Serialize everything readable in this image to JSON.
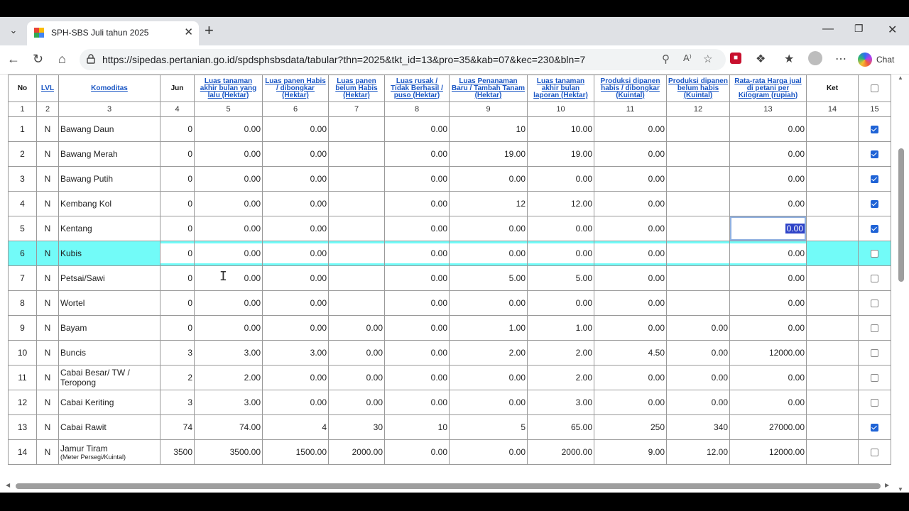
{
  "browser": {
    "tab_title": "SPH-SBS Juli tahun 2025",
    "url": "https://sipedas.pertanian.go.id/spdsphsbsdata/tabular?thn=2025&tkt_id=13&pro=35&kab=07&kec=230&bln=7",
    "chat_label": "Chat"
  },
  "table": {
    "headers": {
      "no": "No",
      "lvl": "LVL",
      "komoditas": "Komoditas",
      "jun": "Jun",
      "h5": "Luas tanaman akhir bulan yang lalu (Hektar)",
      "h6": "Luas panen Habis / dibongkar (Hektar)",
      "h7": "Luas panen belum Habis (Hektar)",
      "h8": "Luas rusak / Tidak Berhasil / puso (Hektar)",
      "h9": "Luas Penanaman Baru / Tambah Tanam (Hektar)",
      "h10": "Luas tanaman akhir bulan laporan (Hektar)",
      "h11": "Produksi dipanen habis / dibongkar (Kuintal)",
      "h12": "Produksi dipanen belum habis (Kuintal)",
      "h13": "Rata-rata Harga jual di petani per Kilogram (rupiah)",
      "ket": "Ket"
    },
    "colnums": [
      "1",
      "2",
      "3",
      "4",
      "5",
      "6",
      "7",
      "8",
      "9",
      "10",
      "11",
      "12",
      "13",
      "14",
      "15"
    ],
    "rows": [
      {
        "no": "1",
        "lvl": "N",
        "name": "Bawang Daun",
        "jun": "0",
        "c5": "0.00",
        "c6": "0.00",
        "c7": "",
        "c8": "0.00",
        "c9": "10",
        "c10": "10.00",
        "c11": "0.00",
        "c12": "",
        "c13": "0.00",
        "checked": true
      },
      {
        "no": "2",
        "lvl": "N",
        "name": "Bawang Merah",
        "jun": "0",
        "c5": "0.00",
        "c6": "0.00",
        "c7": "",
        "c8": "0.00",
        "c9": "19.00",
        "c10": "19.00",
        "c11": "0.00",
        "c12": "",
        "c13": "0.00",
        "checked": true
      },
      {
        "no": "3",
        "lvl": "N",
        "name": "Bawang Putih",
        "jun": "0",
        "c5": "0.00",
        "c6": "0.00",
        "c7": "",
        "c8": "0.00",
        "c9": "0.00",
        "c10": "0.00",
        "c11": "0.00",
        "c12": "",
        "c13": "0.00",
        "checked": true
      },
      {
        "no": "4",
        "lvl": "N",
        "name": "Kembang Kol",
        "jun": "0",
        "c5": "0.00",
        "c6": "0.00",
        "c7": "",
        "c8": "0.00",
        "c9": "12",
        "c10": "12.00",
        "c11": "0.00",
        "c12": "",
        "c13": "0.00",
        "checked": true
      },
      {
        "no": "5",
        "lvl": "N",
        "name": "Kentang",
        "jun": "0",
        "c5": "0.00",
        "c6": "0.00",
        "c7": "",
        "c8": "0.00",
        "c9": "0.00",
        "c10": "0.00",
        "c11": "0.00",
        "c12": "",
        "c13": "0.00",
        "checked": true
      },
      {
        "no": "6",
        "lvl": "N",
        "name": "Kubis",
        "jun": "0",
        "c5": "0.00",
        "c6": "0.00",
        "c7": "",
        "c8": "0.00",
        "c9": "0.00",
        "c10": "0.00",
        "c11": "0.00",
        "c12": "",
        "c13": "0.00",
        "checked": false
      },
      {
        "no": "7",
        "lvl": "N",
        "name": "Petsai/Sawi",
        "jun": "0",
        "c5": "0.00",
        "c6": "0.00",
        "c7": "",
        "c8": "0.00",
        "c9": "5.00",
        "c10": "5.00",
        "c11": "0.00",
        "c12": "",
        "c13": "0.00",
        "checked": false
      },
      {
        "no": "8",
        "lvl": "N",
        "name": "Wortel",
        "jun": "0",
        "c5": "0.00",
        "c6": "0.00",
        "c7": "",
        "c8": "0.00",
        "c9": "0.00",
        "c10": "0.00",
        "c11": "0.00",
        "c12": "",
        "c13": "0.00",
        "checked": false
      },
      {
        "no": "9",
        "lvl": "N",
        "name": "Bayam",
        "jun": "0",
        "c5": "0.00",
        "c6": "0.00",
        "c7": "0.00",
        "c8": "0.00",
        "c9": "1.00",
        "c10": "1.00",
        "c11": "0.00",
        "c12": "0.00",
        "c13": "0.00",
        "checked": false
      },
      {
        "no": "10",
        "lvl": "N",
        "name": "Buncis",
        "jun": "3",
        "c5": "3.00",
        "c6": "3.00",
        "c7": "0.00",
        "c8": "0.00",
        "c9": "2.00",
        "c10": "2.00",
        "c11": "4.50",
        "c12": "0.00",
        "c13": "12000.00",
        "checked": false
      },
      {
        "no": "11",
        "lvl": "N",
        "name": "Cabai Besar/ TW / Teropong",
        "jun": "2",
        "c5": "2.00",
        "c6": "0.00",
        "c7": "0.00",
        "c8": "0.00",
        "c9": "0.00",
        "c10": "2.00",
        "c11": "0.00",
        "c12": "0.00",
        "c13": "0.00",
        "checked": false
      },
      {
        "no": "12",
        "lvl": "N",
        "name": "Cabai Keriting",
        "jun": "3",
        "c5": "3.00",
        "c6": "0.00",
        "c7": "0.00",
        "c8": "0.00",
        "c9": "0.00",
        "c10": "3.00",
        "c11": "0.00",
        "c12": "0.00",
        "c13": "0.00",
        "checked": false
      },
      {
        "no": "13",
        "lvl": "N",
        "name": "Cabai Rawit",
        "jun": "74",
        "c5": "74.00",
        "c6": "4",
        "c7": "30",
        "c8": "10",
        "c9": "5",
        "c10": "65.00",
        "c11": "250",
        "c12": "340",
        "c13": "27000.00",
        "checked": true
      },
      {
        "no": "14",
        "lvl": "N",
        "name": "Jamur Tiram",
        "sub": "(Meter Persegi/Kuintal)",
        "jun": "3500",
        "c5": "3500.00",
        "c6": "1500.00",
        "c7": "2000.00",
        "c8": "0.00",
        "c9": "0.00",
        "c10": "2000.00",
        "c11": "9.00",
        "c12": "12.00",
        "c13": "12000.00",
        "checked": false
      }
    ],
    "highlight_row": "6",
    "selected_row": "5"
  }
}
